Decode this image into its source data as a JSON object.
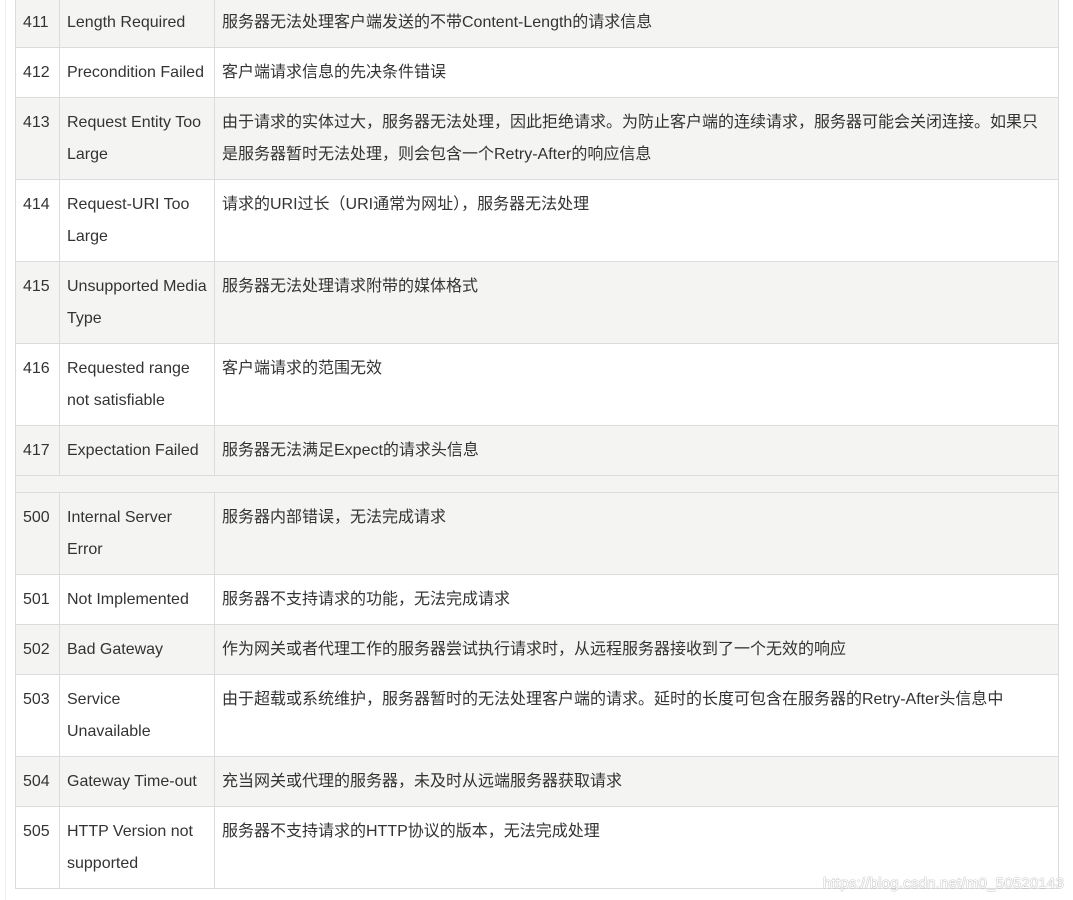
{
  "rows": [
    {
      "code": "411",
      "phrase": "Length Required",
      "desc": "服务器无法处理客户端发送的不带Content-Length的请求信息"
    },
    {
      "code": "412",
      "phrase": "Precondition Failed",
      "desc": "客户端请求信息的先决条件错误"
    },
    {
      "code": "413",
      "phrase": "Request Entity Too Large",
      "desc": "由于请求的实体过大，服务器无法处理，因此拒绝请求。为防止客户端的连续请求，服务器可能会关闭连接。如果只是服务器暂时无法处理，则会包含一个Retry-After的响应信息"
    },
    {
      "code": "414",
      "phrase": "Request-URI Too Large",
      "desc": "请求的URI过长（URI通常为网址），服务器无法处理"
    },
    {
      "code": "415",
      "phrase": "Unsupported Media Type",
      "desc": "服务器无法处理请求附带的媒体格式"
    },
    {
      "code": "416",
      "phrase": "Requested range not satisfiable",
      "desc": "客户端请求的范围无效"
    },
    {
      "code": "417",
      "phrase": "Expectation Failed",
      "desc": "服务器无法满足Expect的请求头信息"
    },
    {
      "code": "500",
      "phrase": "Internal Server Error",
      "desc": "服务器内部错误，无法完成请求"
    },
    {
      "code": "501",
      "phrase": "Not Implemented",
      "desc": "服务器不支持请求的功能，无法完成请求"
    },
    {
      "code": "502",
      "phrase": "Bad Gateway",
      "desc": "作为网关或者代理工作的服务器尝试执行请求时，从远程服务器接收到了一个无效的响应"
    },
    {
      "code": "503",
      "phrase": "Service Unavailable",
      "desc": "由于超载或系统维护，服务器暂时的无法处理客户端的请求。延时的长度可包含在服务器的Retry-After头信息中"
    },
    {
      "code": "504",
      "phrase": "Gateway Time-out",
      "desc": "充当网关或代理的服务器，未及时从远端服务器获取请求"
    },
    {
      "code": "505",
      "phrase": "HTTP Version not supported",
      "desc": "服务器不支持请求的HTTP协议的版本，无法完成处理"
    }
  ],
  "watermark": "https://blog.csdn.net/m0_50520143",
  "colors": {
    "shaded_row": "#f4f4f2",
    "plain_row": "#ffffff",
    "border": "#dcdcdc",
    "text": "#333333"
  }
}
